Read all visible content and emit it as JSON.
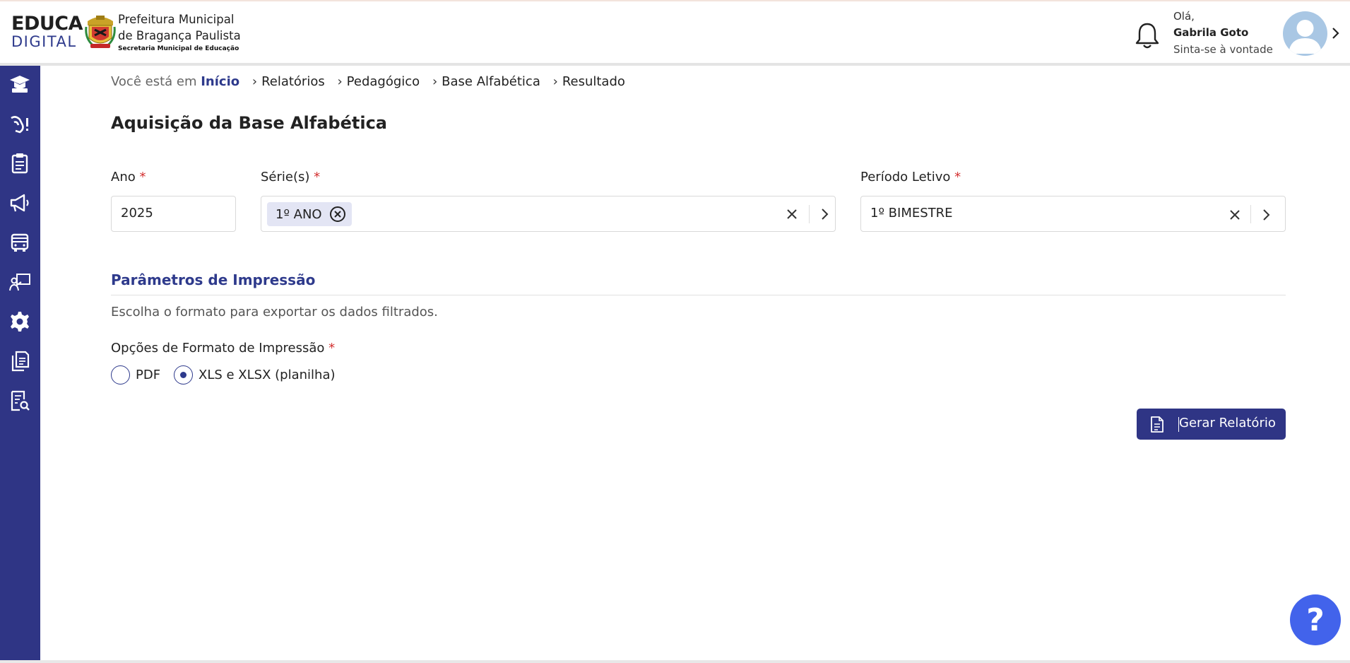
{
  "header": {
    "brand_top": "EDUCA",
    "brand_bottom": "DIGITAL",
    "prefeitura_line1": "Prefeitura Municipal",
    "prefeitura_line2": "de Bragança Paulista",
    "secretaria": "Secretaria Municipal de Educação",
    "greeting": "Olá,",
    "user_name": "Gabrila Goto",
    "user_subtitle": "Sinta-se à vontade"
  },
  "sidebar": {
    "items": [
      "graduation-cap-icon",
      "hand-alert-icon",
      "clipboard-icon",
      "megaphone-icon",
      "bus-icon",
      "teacher-board-icon",
      "gear-icon",
      "documents-icon",
      "report-search-icon"
    ]
  },
  "breadcrumb": {
    "prefix": "Você está em",
    "home": "Início",
    "items": [
      "Relatórios",
      "Pedagógico",
      "Base Alfabética",
      "Resultado"
    ]
  },
  "page": {
    "title": "Aquisição da Base Alfabética"
  },
  "filters": {
    "ano": {
      "label": "Ano",
      "required": "*",
      "value": "2025"
    },
    "series": {
      "label": "Série(s)",
      "required": "*",
      "chip": "1º ANO"
    },
    "periodo": {
      "label": "Período Letivo",
      "required": "*",
      "value": "1º BIMESTRE"
    }
  },
  "print_params": {
    "title": "Parâmetros de Impressão",
    "description": "Escolha o formato para exportar os dados filtrados.",
    "options_label": "Opções de Formato de Impressão",
    "required": "*",
    "options": [
      {
        "label": "PDF",
        "selected": false
      },
      {
        "label": "XLS e XLSX (planilha)",
        "selected": true
      }
    ]
  },
  "actions": {
    "generate_label": "Gerar Relatório"
  },
  "help": {
    "symbol": "?"
  },
  "colors": {
    "primary": "#2f3585",
    "accent_text": "#2e3a8c",
    "required": "#d32f2f",
    "help_button": "#4263eb"
  }
}
